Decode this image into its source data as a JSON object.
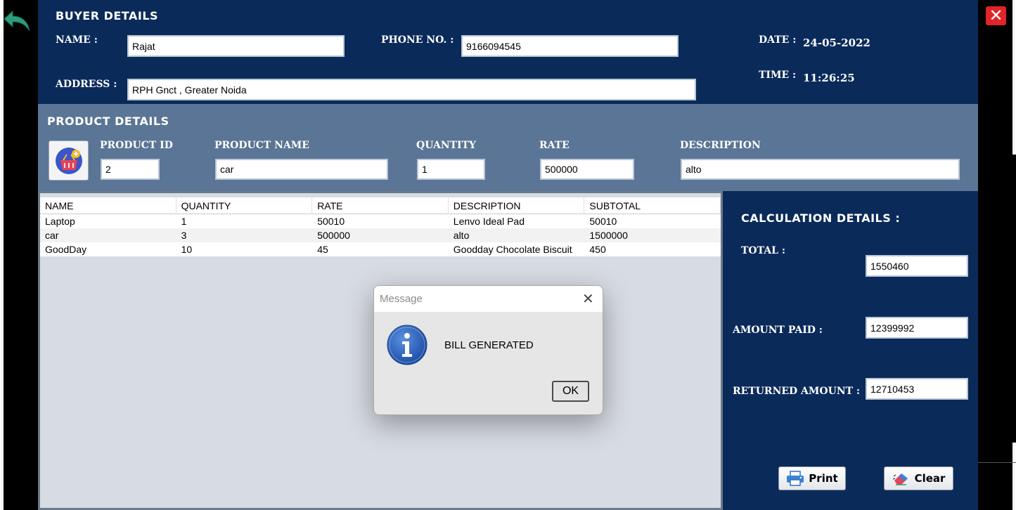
{
  "buyer": {
    "heading": "BUYER DETAILS",
    "name_label": "NAME :",
    "name_value": "Rajat",
    "phone_label": "PHONE NO. :",
    "phone_value": "9166094545",
    "date_label": "DATE :",
    "date_value": "24-05-2022",
    "time_label": "TIME :",
    "time_value": "11:26:25",
    "address_label": "ADDRESS :",
    "address_value": "RPH Gnct , Greater Noida"
  },
  "product": {
    "heading": "PRODUCT DETAILS",
    "id_label": "PRODUCT ID",
    "id_value": "2",
    "name_label": "PRODUCT NAME",
    "name_value": "car",
    "qty_label": "QUANTITY",
    "qty_value": "1",
    "rate_label": "RATE",
    "rate_value": "500000",
    "desc_label": "DESCRIPTION",
    "desc_value": "alto"
  },
  "table": {
    "columns": [
      "NAME",
      "QUANTITY",
      "RATE",
      "DESCRIPTION",
      "SUBTOTAL"
    ],
    "rows": [
      [
        "Laptop",
        "1",
        "50010",
        "Lenvo Ideal Pad",
        "50010"
      ],
      [
        "car",
        "3",
        "500000",
        "alto",
        "1500000"
      ],
      [
        "GoodDay",
        "10",
        "45",
        "Goodday Chocolate Biscuit",
        "450"
      ]
    ]
  },
  "calc": {
    "heading": "CALCULATION DETAILS :",
    "total_label": "TOTAL :",
    "total_value": "1550460",
    "paid_label": "AMOUNT PAID :",
    "paid_value": "12399992",
    "returned_label": "RETURNED AMOUNT :",
    "returned_value": "12710453"
  },
  "buttons": {
    "print_label": "Print",
    "clear_label": "Clear"
  },
  "dialog": {
    "title": "Message",
    "message": "BILL  GENERATED",
    "ok_label": "OK"
  },
  "icons": {
    "back": "back-arrow-icon",
    "close": "close-icon",
    "product": "cart-icon",
    "info": "info-icon",
    "print": "printer-icon",
    "clear": "eraser-icon"
  },
  "colors": {
    "header_blue": "#0a2a5a",
    "product_band": "#5a7595",
    "close_red": "#e0242a",
    "back_teal": "#2a9d7f"
  }
}
